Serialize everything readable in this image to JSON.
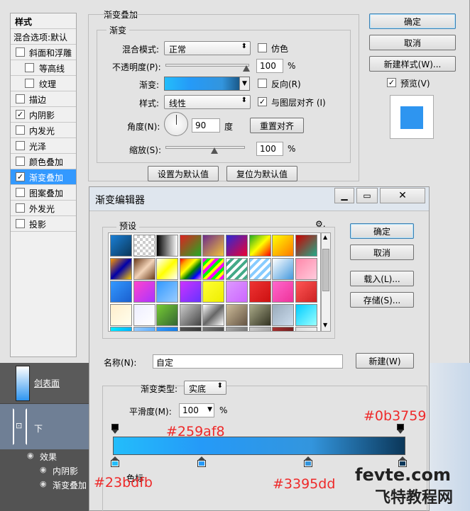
{
  "layer_style": {
    "styles_header": "样式",
    "blend_options": "混合选项:默认",
    "items": [
      {
        "label": "斜面和浮雕",
        "checked": false,
        "indent": false
      },
      {
        "label": "等高线",
        "checked": false,
        "indent": true
      },
      {
        "label": "纹理",
        "checked": false,
        "indent": true
      },
      {
        "label": "描边",
        "checked": false,
        "indent": false
      },
      {
        "label": "内阴影",
        "checked": true,
        "indent": false
      },
      {
        "label": "内发光",
        "checked": false,
        "indent": false
      },
      {
        "label": "光泽",
        "checked": false,
        "indent": false
      },
      {
        "label": "颜色叠加",
        "checked": false,
        "indent": false
      },
      {
        "label": "渐变叠加",
        "checked": true,
        "indent": false,
        "selected": true
      },
      {
        "label": "图案叠加",
        "checked": false,
        "indent": false
      },
      {
        "label": "外发光",
        "checked": false,
        "indent": false
      },
      {
        "label": "投影",
        "checked": false,
        "indent": false
      }
    ],
    "section_title": "渐变叠加",
    "group_title": "渐变",
    "blend_mode_label": "混合模式:",
    "blend_mode_value": "正常",
    "dither_label": "仿色",
    "opacity_label": "不透明度(P):",
    "opacity_value": "100",
    "percent": "%",
    "gradient_label": "渐变:",
    "reverse_label": "反向(R)",
    "style_label": "样式:",
    "style_value": "线性",
    "align_label": "与图层对齐 (I)",
    "align_checked": true,
    "angle_label": "角度(N):",
    "angle_value": "90",
    "degree": "度",
    "reset_align": "重置对齐",
    "scale_label": "缩放(S):",
    "scale_value": "100",
    "set_default": "设置为默认值",
    "reset_default": "复位为默认值",
    "ok": "确定",
    "cancel": "取消",
    "new_style": "新建样式(W)...",
    "preview_label": "预览(V)",
    "preview_checked": true,
    "preview_color": "#2e95f0"
  },
  "gradient_editor": {
    "title": "渐变编辑器",
    "presets_label": "预设",
    "ok": "确定",
    "cancel": "取消",
    "load": "载入(L)...",
    "save": "存储(S)...",
    "name_label": "名称(N):",
    "name_value": "自定",
    "new": "新建(W)",
    "type_label": "渐变类型:",
    "type_value": "实底",
    "smooth_label": "平滑度(M):",
    "smooth_value": "100",
    "percent": "%",
    "stops_label": "色标",
    "colors": {
      "start": "#23bdfb",
      "mid1": "#259af8",
      "mid2": "#3395dd",
      "end": "#0b3759"
    }
  },
  "layers_panel": {
    "layer1_name": "剑表面",
    "layer2_name": "下",
    "effects_label": "效果",
    "effect1": "内阴影",
    "effect2": "渐变叠加"
  },
  "annotations": {
    "a_end": "#0b3759",
    "a_mid1": "#259af8",
    "a_start": "#23bdfb",
    "a_mid2": "#3395dd"
  },
  "watermark": {
    "line1": "fevte.com",
    "line2": "飞特教程网"
  }
}
